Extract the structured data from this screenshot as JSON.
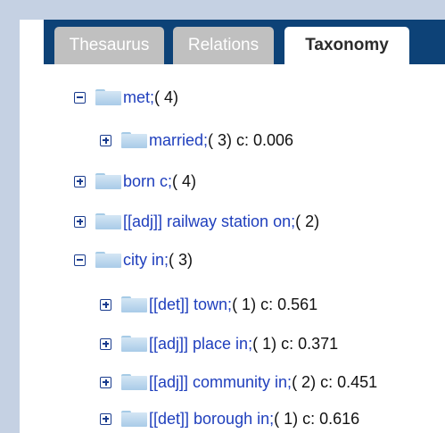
{
  "tabs": [
    {
      "label": "Thesaurus",
      "active": false
    },
    {
      "label": "Relations",
      "active": false
    },
    {
      "label": "Taxonomy",
      "active": true
    }
  ],
  "tree": [
    {
      "label": "met;",
      "meta": " ( 4)",
      "state": "expanded",
      "level": 1
    },
    {
      "label": "married;",
      "meta": " ( 3) c: 0.006",
      "state": "collapsed",
      "level": 2
    },
    {
      "label": "born c;",
      "meta": " ( 4)",
      "state": "collapsed",
      "level": 1
    },
    {
      "label": "[[adj]] railway station on;",
      "meta": " ( 2)",
      "state": "collapsed",
      "level": 1
    },
    {
      "label": "city in;",
      "meta": " ( 3)",
      "state": "expanded",
      "level": 1
    },
    {
      "label": "[[det]] town;",
      "meta": " ( 1) c: 0.561",
      "state": "collapsed",
      "level": 2
    },
    {
      "label": "[[adj]] place in;",
      "meta": " ( 1) c: 0.371",
      "state": "collapsed",
      "level": 2
    },
    {
      "label": "[[adj]] community in;",
      "meta": " ( 2) c: 0.451",
      "state": "collapsed",
      "level": 2
    },
    {
      "label": "[[det]] borough in;",
      "meta": " ( 1) c: 0.616",
      "state": "collapsed",
      "level": 2
    }
  ],
  "colors": {
    "tabbar": "#0d4277",
    "link": "#1f3fbd",
    "toggle": "#1a3c8e",
    "folder": "#a9cbe8",
    "frame": "#c5d1e3"
  },
  "icons": {
    "expanded": "minus-box-icon",
    "collapsed": "plus-box-icon",
    "node": "folder-icon"
  }
}
